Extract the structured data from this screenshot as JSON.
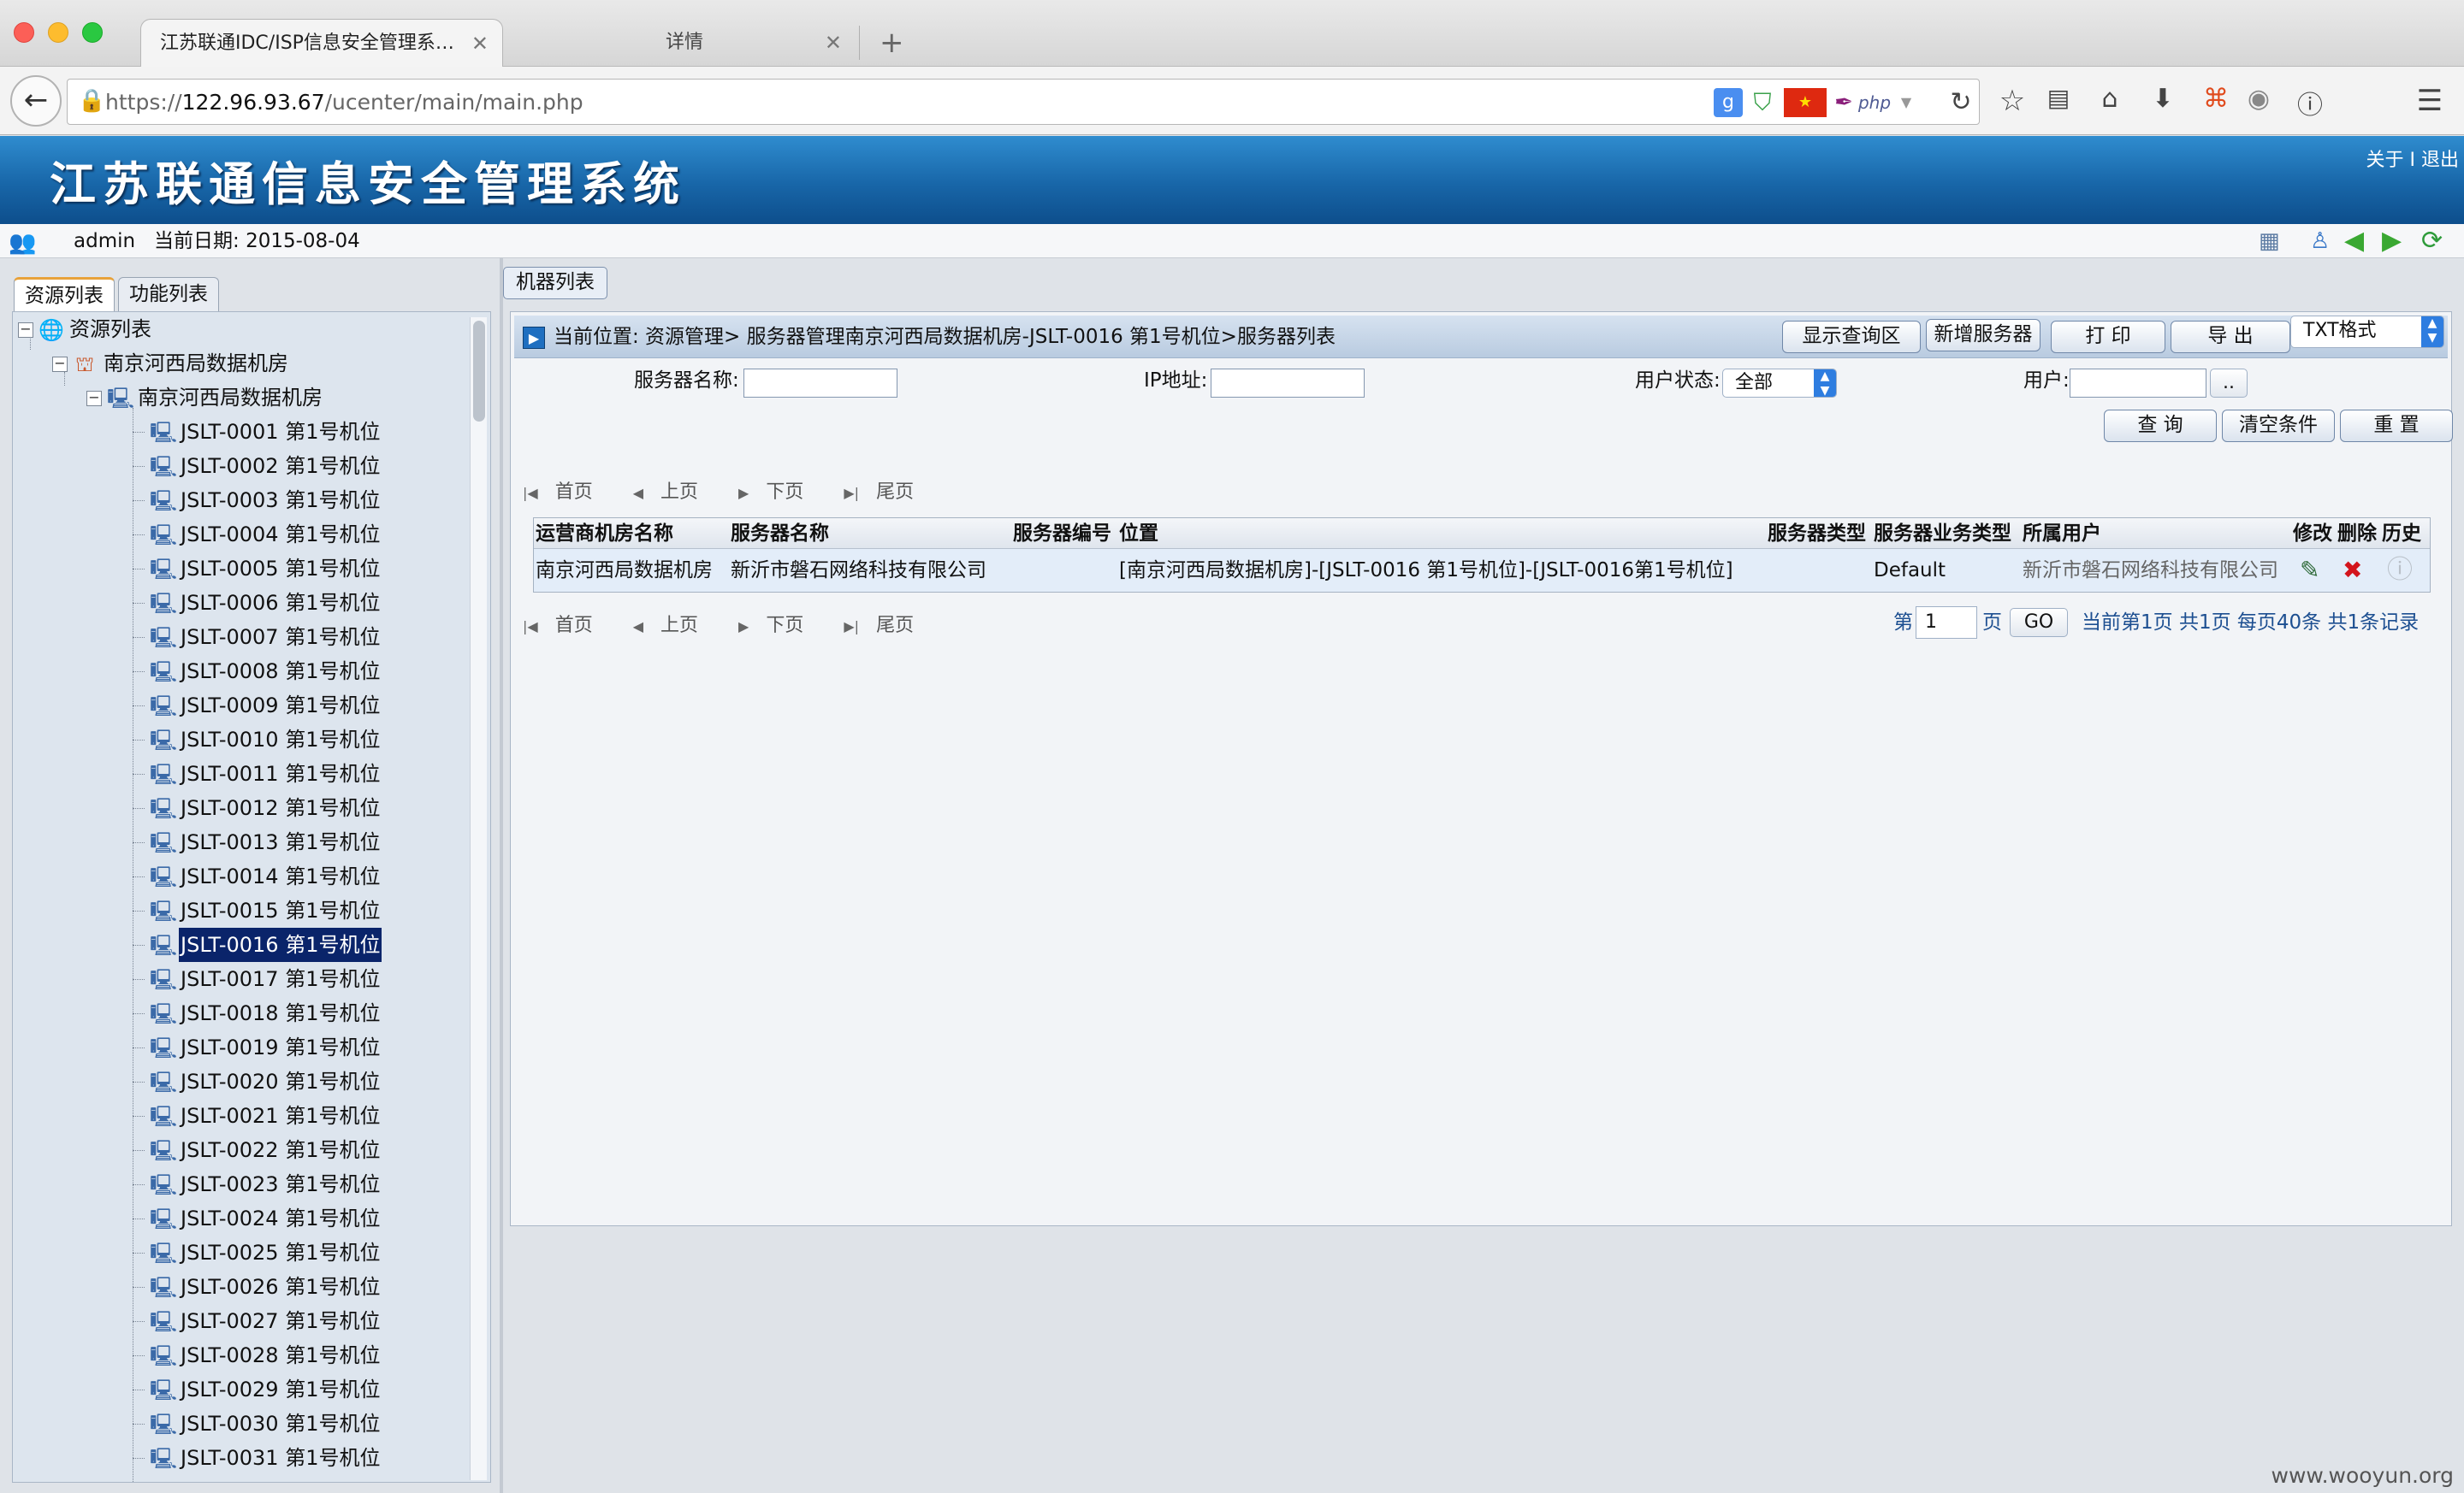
{
  "browser": {
    "active_tab": "江苏联通IDC/ISP信息安全管理系…",
    "inactive_tab": "详情",
    "url_prefix": "https://",
    "url_host": "122.96.93.67",
    "url_path": "/ucenter/main/main.php"
  },
  "app": {
    "title": "江苏联通信息安全管理系统",
    "about": "关于",
    "sep": "I",
    "logout": "退出"
  },
  "userbar": {
    "user": "admin",
    "date_label": "当前日期:",
    "date": "2015-08-04"
  },
  "left": {
    "tabs": [
      "资源列表",
      "功能列表"
    ],
    "tree": {
      "root": "资源列表",
      "datacenter": "南京河西局数据机房",
      "room": "南京河西局数据机房",
      "selected_index": 15,
      "positions": [
        "JSLT-0001 第1号机位",
        "JSLT-0002 第1号机位",
        "JSLT-0003 第1号机位",
        "JSLT-0004 第1号机位",
        "JSLT-0005 第1号机位",
        "JSLT-0006 第1号机位",
        "JSLT-0007 第1号机位",
        "JSLT-0008 第1号机位",
        "JSLT-0009 第1号机位",
        "JSLT-0010 第1号机位",
        "JSLT-0011 第1号机位",
        "JSLT-0012 第1号机位",
        "JSLT-0013 第1号机位",
        "JSLT-0014 第1号机位",
        "JSLT-0015 第1号机位",
        "JSLT-0016 第1号机位",
        "JSLT-0017 第1号机位",
        "JSLT-0018 第1号机位",
        "JSLT-0019 第1号机位",
        "JSLT-0020 第1号机位",
        "JSLT-0021 第1号机位",
        "JSLT-0022 第1号机位",
        "JSLT-0023 第1号机位",
        "JSLT-0024 第1号机位",
        "JSLT-0025 第1号机位",
        "JSLT-0026 第1号机位",
        "JSLT-0027 第1号机位",
        "JSLT-0028 第1号机位",
        "JSLT-0029 第1号机位",
        "JSLT-0030 第1号机位",
        "JSLT-0031 第1号机位"
      ]
    }
  },
  "main": {
    "tab": "机器列表",
    "location": "当前位置: 资源管理> 服务器管理南京河西局数据机房-JSLT-0016 第1号机位>服务器列表",
    "buttons": {
      "show_query": "显示查询区",
      "add_server": "新增服务器",
      "print": "打 印",
      "export": "导 出",
      "format": "TXT格式"
    },
    "filters": {
      "server_name_label": "服务器名称:",
      "ip_label": "IP地址:",
      "user_status_label": "用户状态:",
      "user_status_value": "全部",
      "user_label": "用户:",
      "pick": ".."
    },
    "actions": {
      "query": "查 询",
      "clear": "清空条件",
      "reset": "重 置"
    },
    "pager": {
      "first": "首页",
      "prev": "上页",
      "next": "下页",
      "last": "尾页"
    },
    "table": {
      "columns": [
        "运营商机房名称",
        "服务器名称",
        "服务器编号",
        "位置",
        "服务器类型",
        "服务器业务类型",
        "所属用户",
        "修改",
        "删除",
        "历史"
      ],
      "rows": [
        {
          "room": "南京河西局数据机房",
          "name": "新沂市磐石网络科技有限公司",
          "number": "",
          "location": "[南京河西局数据机房]-[JSLT-0016 第1号机位]-[JSLT-0016第1号机位]",
          "type": "",
          "biz_type": "Default",
          "owner": "新沂市磐石网络科技有限公司"
        }
      ]
    },
    "page_info": {
      "page_prefix": "第",
      "page_value": "1",
      "page_suffix": "页",
      "go": "GO",
      "summary": "当前第1页 共1页 每页40条 共1条记录"
    }
  },
  "watermark": "www.wooyun.org",
  "icons": {
    "tree_root": "globe-icon",
    "tree_datacenter": "building-icon",
    "tree_node": "computer-icon",
    "edit": "edit-icon",
    "delete": "delete-icon",
    "history": "history-icon"
  },
  "colors": {
    "header_blue": "#1866a8",
    "selected": "#0a246a",
    "row_bg": "#e3edf9",
    "link_blue": "#1d4f91"
  }
}
